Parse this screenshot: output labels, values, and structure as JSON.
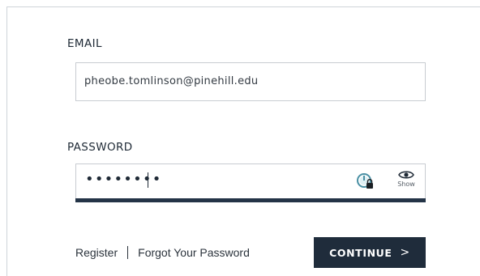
{
  "form": {
    "email": {
      "label": "EMAIL",
      "value": "pheobe.tomlinson@pinehill.edu"
    },
    "password": {
      "label": "PASSWORD",
      "value": "••••••••",
      "show_label": "Show",
      "password_manager_icon": "password-manager-lock-icon",
      "show_icon": "eye-icon"
    },
    "links": {
      "register": "Register",
      "forgot": "Forgot Your Password"
    },
    "continue_button": {
      "label": "CONTINUE",
      "chevron": ">"
    }
  },
  "colors": {
    "primary": "#1f2c3b",
    "input_border": "#c8ccd1",
    "text": "#1f2a36",
    "password_manager_icon": "#4a90a4"
  }
}
